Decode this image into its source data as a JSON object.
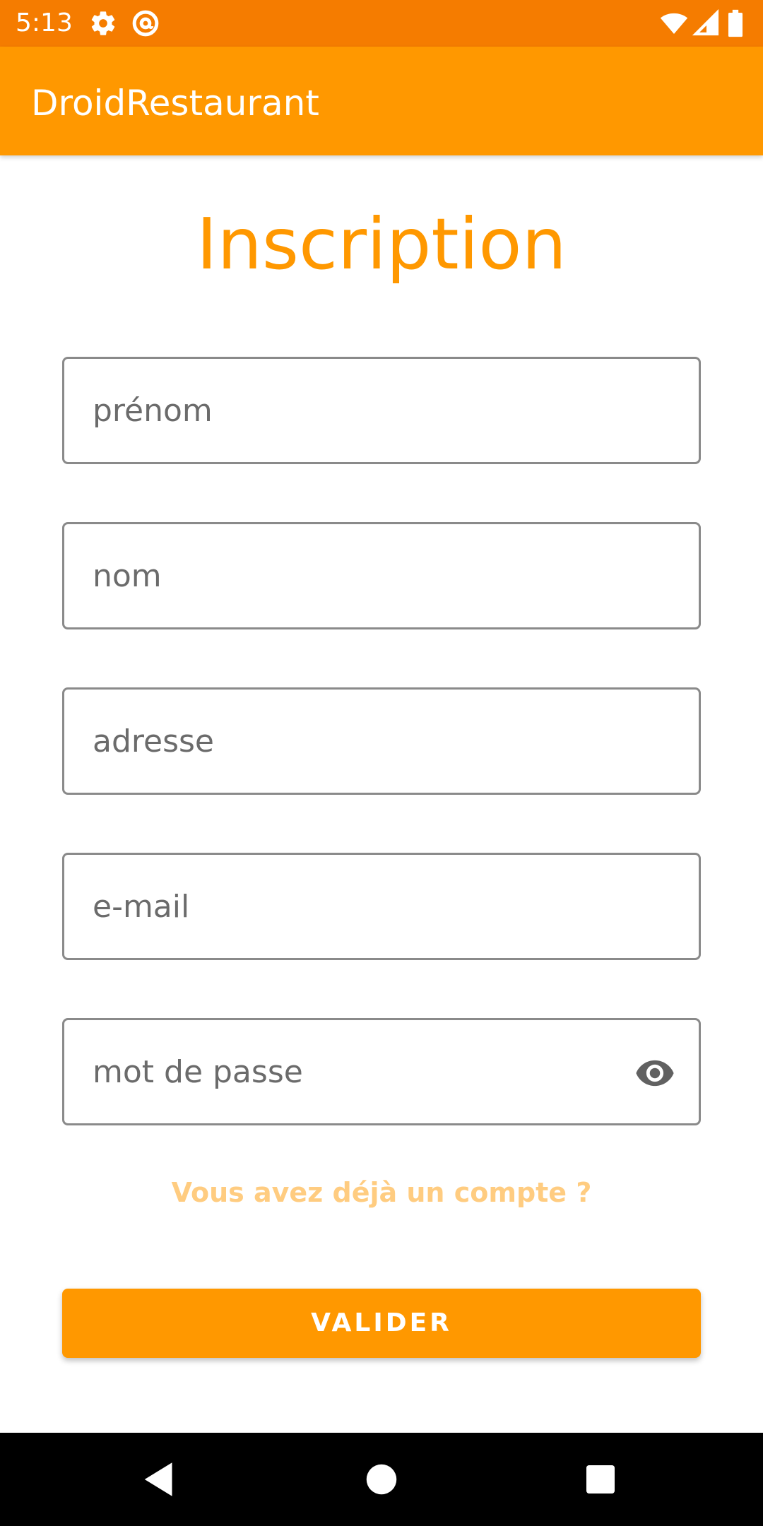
{
  "status_bar": {
    "time": "5:13",
    "icons": [
      "gear-icon",
      "at-sign-icon",
      "wifi-icon",
      "cell-signal-icon",
      "battery-icon"
    ]
  },
  "app_bar": {
    "title": "DroidRestaurant"
  },
  "page": {
    "heading": "Inscription"
  },
  "form": {
    "first_name": {
      "placeholder": "prénom",
      "value": ""
    },
    "last_name": {
      "placeholder": "nom",
      "value": ""
    },
    "address": {
      "placeholder": "adresse",
      "value": ""
    },
    "email": {
      "placeholder": "e-mail",
      "value": ""
    },
    "password": {
      "placeholder": "mot de passe",
      "value": "",
      "toggle_icon": "eye-icon"
    }
  },
  "login_link": "Vous avez déjà un compte ?",
  "submit_label": "VALIDER",
  "navigation": {
    "icons": [
      "back-icon",
      "home-icon",
      "recents-icon"
    ]
  },
  "colors": {
    "status_bar": "#f57c00",
    "primary": "#ff9800",
    "link": "#ffcc80",
    "field_border": "#8a8a8a",
    "nav_bar": "#000000"
  }
}
